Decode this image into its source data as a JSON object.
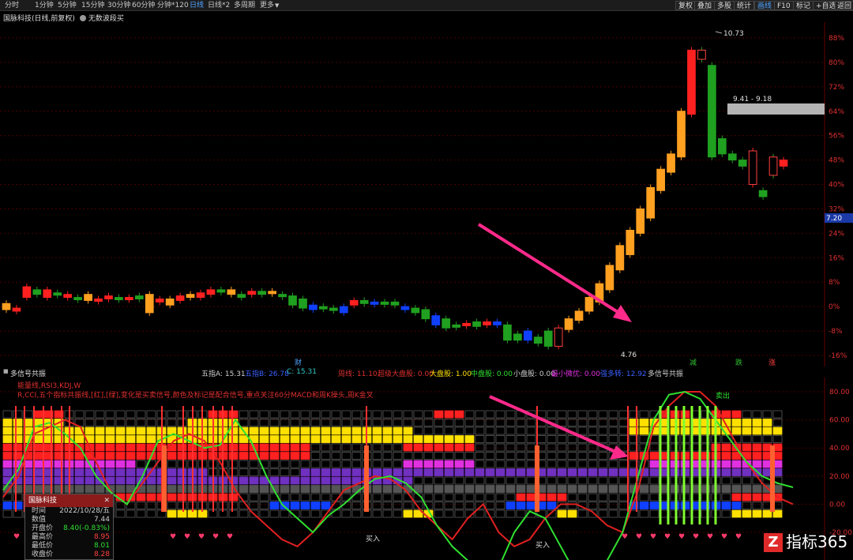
{
  "toolbar": {
    "tabs": [
      {
        "label": "分时"
      },
      {
        "label": "1分钟"
      },
      {
        "label": "5分钟"
      },
      {
        "label": "15分钟"
      },
      {
        "label": "30分钟"
      },
      {
        "label": "60分钟"
      },
      {
        "label": "分钟*120"
      },
      {
        "label": "日线"
      },
      {
        "label": "日线*2"
      },
      {
        "label": "多周期"
      },
      {
        "label": "更多"
      }
    ],
    "active_tab": "日线",
    "right_buttons": [
      {
        "label": "复权"
      },
      {
        "label": "叠加"
      },
      {
        "label": "多股"
      },
      {
        "label": "统计"
      },
      {
        "label": "画线"
      },
      {
        "label": "F10"
      },
      {
        "label": "标记"
      },
      {
        "label": "+自选"
      },
      {
        "label": "返回"
      }
    ],
    "active_right": "画线"
  },
  "title": {
    "stock": "国脉科技(日线,前复权)",
    "indicator": "无数波段买"
  },
  "price_axis": {
    "labels": [
      "88%",
      "80%",
      "72%",
      "64%",
      "56%",
      "48%",
      "40%",
      "32%",
      "24%",
      "16%",
      "8%",
      "0%",
      "-8%",
      "-16%"
    ],
    "current_price": "7.20"
  },
  "main_chart": {
    "high_label": "10.73",
    "low_label": "4.76",
    "zone_label": "9.41 - 9.18",
    "markers": [
      {
        "text": "财"
      },
      {
        "text": "减"
      },
      {
        "text": "跌"
      },
      {
        "text": "涨"
      }
    ]
  },
  "info_row": {
    "panel_name": "多信号共振",
    "items": [
      {
        "text": "五指A: 15.31",
        "color": "#d0d0d0"
      },
      {
        "text": "五指B: 26.78",
        "color": "#3a60ff"
      },
      {
        "text": "C: 15.31",
        "color": "#30c8c8"
      },
      {
        "text": "周线: 11.10",
        "color": "#e03030"
      },
      {
        "text": "超级大盘股: 0.00",
        "color": "#e03030"
      },
      {
        "text": "大盘股: 1.00",
        "color": "#ffe000"
      },
      {
        "text": "中盘股: 0.00",
        "color": "#30e030"
      },
      {
        "text": "小盘股: 0.00",
        "color": "#d0d0d0"
      },
      {
        "text": "最小微优: 0.00",
        "color": "#e030e0"
      },
      {
        "text": "强多转: 12.92",
        "color": "#3a60ff"
      },
      {
        "text": "多信号共振",
        "color": "#d0d0d0"
      }
    ]
  },
  "sub_legend": {
    "line1": "能量线,RSI3,KDJ,W",
    "line2": "R,CCI,五个指标共振线,[红],[绿],变化是买卖信号,颜色及标记是配合信号,重点关注60分MACD和周K操头,周K金叉"
  },
  "indicator_axis": {
    "labels": [
      "80.00",
      "60.00",
      "40.00",
      "20.00",
      "0.00",
      "-20.00"
    ]
  },
  "indicator_annotations": {
    "buy1": "买入",
    "buy2": "买入",
    "sell": "卖出"
  },
  "popup": {
    "title": "国脉科技",
    "rows": [
      {
        "label": "时间",
        "value": "2022/10/28/五",
        "color": "#cccccc"
      },
      {
        "label": "数值",
        "value": "7.44",
        "color": "#cccccc"
      },
      {
        "label": "开盘价",
        "value": "8.40(-0.83%)",
        "color": "#30e030"
      },
      {
        "label": "最高价",
        "value": "8.95",
        "color": "#ff4040"
      },
      {
        "label": "最低价",
        "value": "8.01",
        "color": "#30e030"
      },
      {
        "label": "收盘价",
        "value": "8.28",
        "color": "#ff4040"
      }
    ]
  },
  "logo": {
    "text": "指标365"
  },
  "chart_data": {
    "type": "candlestick",
    "series": [
      {
        "o": 1.0,
        "c": -1.0
      },
      {
        "o": -1.5,
        "c": -0.5
      },
      {
        "o": 3.0,
        "c": 6.5
      },
      {
        "o": 5.5,
        "c": 4.0
      },
      {
        "o": 3.0,
        "c": 5.5
      },
      {
        "o": 4.5,
        "c": 4.0
      },
      {
        "o": 3.0,
        "c": 4.0
      },
      {
        "o": 3.0,
        "c": 2.5
      },
      {
        "o": 4.0,
        "c": 2.0
      },
      {
        "o": 2.0,
        "c": 2.5
      },
      {
        "o": 2.5,
        "c": 3.5
      },
      {
        "o": 3.0,
        "c": 3.0
      },
      {
        "o": 2.5,
        "c": 3.0
      },
      {
        "o": 3.5,
        "c": 2.5
      },
      {
        "o": 4.0,
        "c": -2.0
      },
      {
        "o": 1.5,
        "c": 2.5
      },
      {
        "o": 2.5,
        "c": 0.5
      },
      {
        "o": 2.0,
        "c": 3.5
      },
      {
        "o": 4.0,
        "c": 3.0
      },
      {
        "o": 3.0,
        "c": 4.5
      },
      {
        "o": 4.0,
        "c": 5.5
      },
      {
        "o": 5.5,
        "c": 5.0
      },
      {
        "o": 5.5,
        "c": 4.0
      },
      {
        "o": 4.0,
        "c": 3.0
      },
      {
        "o": 4.0,
        "c": 5.0
      },
      {
        "o": 5.0,
        "c": 4.0
      },
      {
        "o": 5.0,
        "c": 4.5
      },
      {
        "o": 4.0,
        "c": 4.0
      },
      {
        "o": 3.5,
        "c": 0.5
      },
      {
        "o": 2.5,
        "c": -0.5
      },
      {
        "o": 0.5,
        "c": -1.0
      },
      {
        "o": 0.0,
        "c": -0.5
      },
      {
        "o": -0.5,
        "c": -1.0
      },
      {
        "o": 0.0,
        "c": -2.0
      },
      {
        "o": 0.5,
        "c": 2.0
      },
      {
        "o": 2.0,
        "c": 1.0
      },
      {
        "o": 1.5,
        "c": 1.0
      },
      {
        "o": 1.5,
        "c": 1.0
      },
      {
        "o": 1.5,
        "c": 0.5
      },
      {
        "o": 0.0,
        "c": -1.0
      },
      {
        "o": -0.5,
        "c": -2.0
      },
      {
        "o": -1.0,
        "c": -4.0
      },
      {
        "o": -3.0,
        "c": -6.0
      },
      {
        "o": -4.0,
        "c": -7.0
      },
      {
        "o": -6.0,
        "c": -6.5
      },
      {
        "o": -6.0,
        "c": -5.5
      },
      {
        "o": -5.0,
        "c": -6.5
      },
      {
        "o": -6.0,
        "c": -5.0
      },
      {
        "o": -5.0,
        "c": -6.0
      },
      {
        "o": -6.0,
        "c": -11.0
      },
      {
        "o": -9.0,
        "c": -11.0
      },
      {
        "o": -8.0,
        "c": -11.0
      },
      {
        "o": -10.0,
        "c": -12.0
      },
      {
        "o": -8.0,
        "c": -13.0
      },
      {
        "o": -13.0,
        "c": -7.0
      },
      {
        "o": -7.5,
        "c": -4.0
      },
      {
        "o": -4.5,
        "c": -1.5
      },
      {
        "o": -1.5,
        "c": 3.0
      },
      {
        "o": 1.5,
        "c": 7.5
      },
      {
        "o": 5.5,
        "c": 13.5
      },
      {
        "o": 12.0,
        "c": 20.0
      },
      {
        "o": 17.0,
        "c": 25.0
      },
      {
        "o": 24.0,
        "c": 32.0
      },
      {
        "o": 29.0,
        "c": 39.0
      },
      {
        "o": 38.0,
        "c": 45.0
      },
      {
        "o": 44.0,
        "c": 50.0
      },
      {
        "o": 49.0,
        "c": 64.0
      },
      {
        "o": 63.0,
        "c": 84.0
      },
      {
        "o": 84.0,
        "c": 81.0
      },
      {
        "o": 79.0,
        "c": 49.0
      },
      {
        "o": 55.0,
        "c": 50.0
      },
      {
        "o": 50.0,
        "c": 48.0
      },
      {
        "o": 48.0,
        "c": 46.0
      },
      {
        "o": 40.0,
        "c": 51.0
      },
      {
        "o": 38.0,
        "c": 36.0
      },
      {
        "o": 49.0,
        "c": 43.0
      },
      {
        "o": 46.0,
        "c": 48.0
      }
    ],
    "ylim": [
      -16,
      88
    ],
    "title": "",
    "xlabel": "",
    "ylabel": ""
  },
  "colors": {
    "up": "#ff2020",
    "down": "#20a020",
    "orange": "#ffa020",
    "blue": "#1040ff",
    "grid": "#4a0000"
  }
}
